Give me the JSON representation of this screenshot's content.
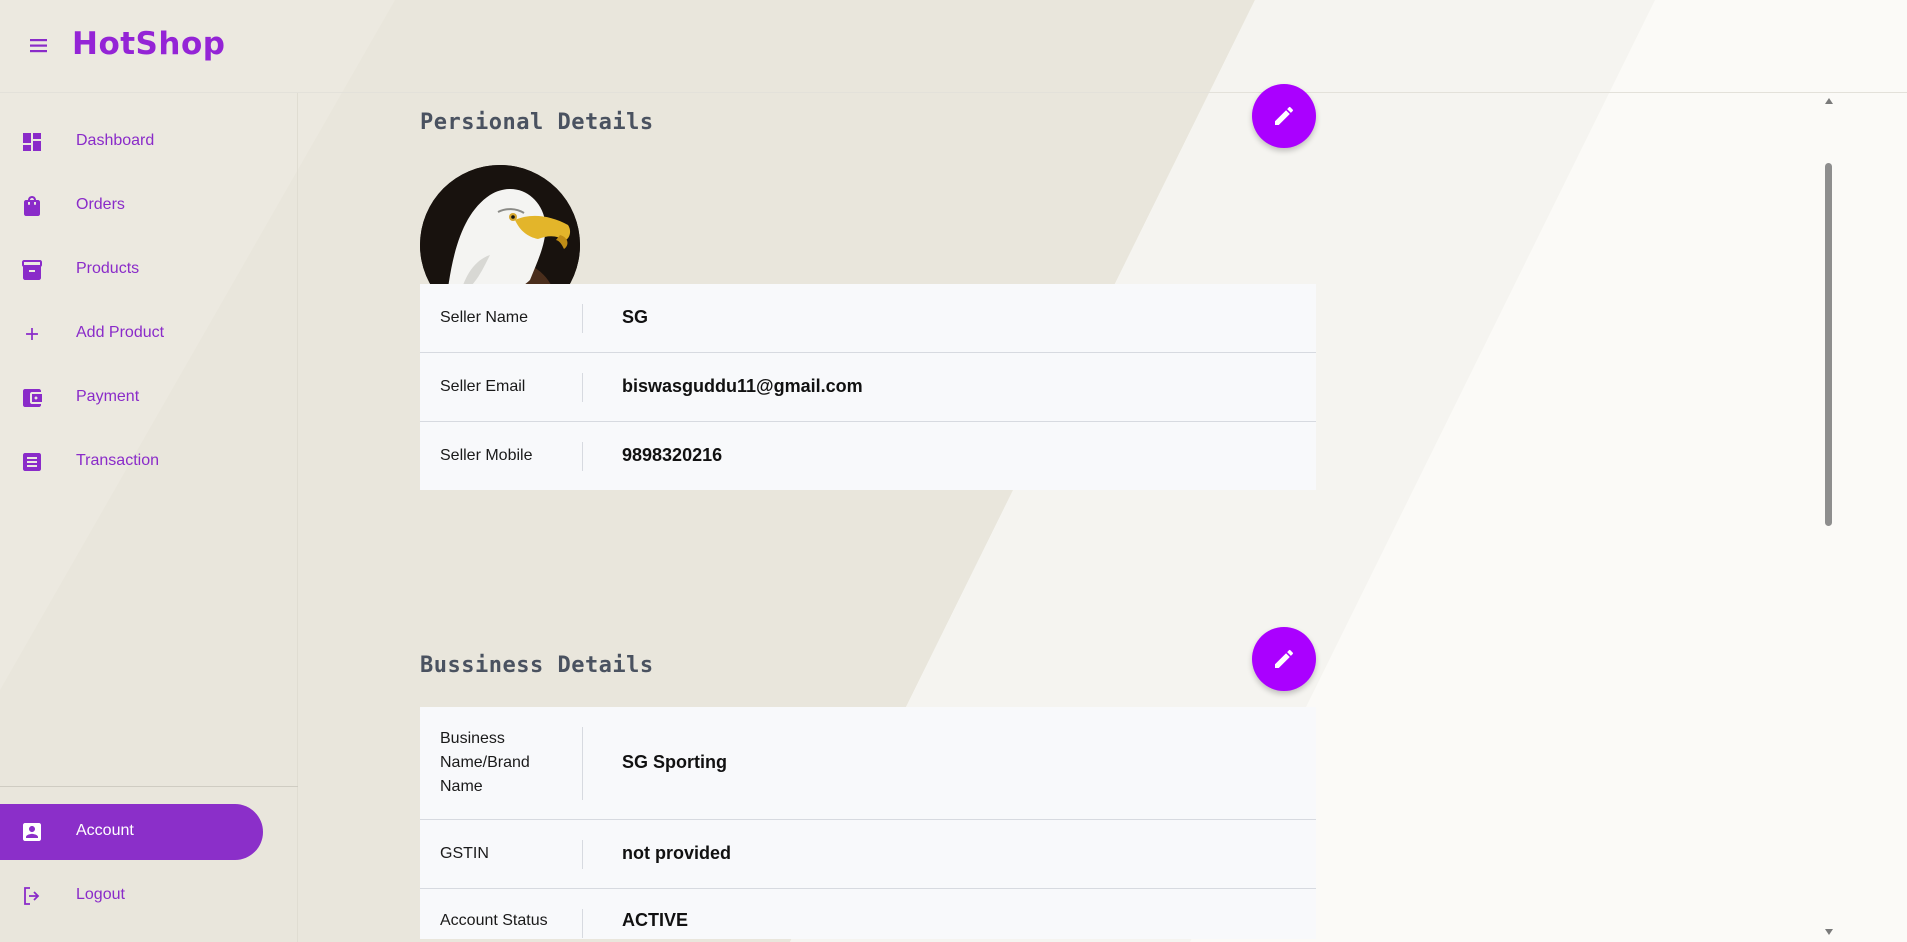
{
  "app": {
    "brand": "HotShop"
  },
  "sidebar": {
    "items": [
      {
        "label": "Dashboard",
        "icon": "dashboard-icon"
      },
      {
        "label": "Orders",
        "icon": "shopping-bag-icon"
      },
      {
        "label": "Products",
        "icon": "inventory-icon"
      },
      {
        "label": "Add Product",
        "icon": "plus-icon"
      },
      {
        "label": "Payment",
        "icon": "wallet-icon"
      },
      {
        "label": "Transaction",
        "icon": "receipt-icon"
      }
    ],
    "bottom_items": [
      {
        "label": "Account",
        "icon": "account-box-icon",
        "active": true
      },
      {
        "label": "Logout",
        "icon": "logout-icon"
      }
    ]
  },
  "personal": {
    "title": "Persional Details",
    "rows": [
      {
        "label": "Seller Name",
        "value": "SG"
      },
      {
        "label": "Seller Email",
        "value": "biswasguddu11@gmail.com"
      },
      {
        "label": "Seller Mobile",
        "value": "9898320216"
      }
    ]
  },
  "business": {
    "title": "Bussiness Details",
    "rows": [
      {
        "label": "Business Name/Brand Name",
        "value": "SG Sporting"
      },
      {
        "label": "GSTIN",
        "value": "not provided"
      },
      {
        "label": "Account Status",
        "value": "ACTIVE"
      }
    ]
  },
  "colors": {
    "brand": "#9424d6",
    "active_nav": "#8b2fc9",
    "fab": "#aa00ff"
  }
}
